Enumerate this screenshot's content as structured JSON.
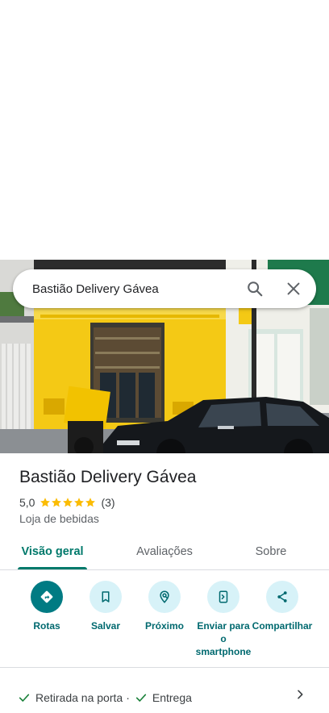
{
  "search": {
    "query": "Bastião Delivery Gávea"
  },
  "place": {
    "name": "Bastião Delivery Gávea",
    "rating": "5,0",
    "rating_value": 5,
    "review_count": "(3)",
    "category": "Loja de bebidas"
  },
  "tabs": [
    {
      "label": "Visão geral",
      "active": true
    },
    {
      "label": "Avaliações",
      "active": false
    },
    {
      "label": "Sobre",
      "active": false
    }
  ],
  "actions": [
    {
      "label": "Rotas",
      "icon": "directions-icon"
    },
    {
      "label": "Salvar",
      "icon": "bookmark-icon"
    },
    {
      "label": "Próximo",
      "icon": "nearby-icon"
    },
    {
      "label": "Enviar para o smartphone",
      "icon": "send-to-phone-icon"
    },
    {
      "label": "Compartilhar",
      "icon": "share-icon"
    }
  ],
  "services": {
    "items": [
      "Retirada na porta",
      "Entrega"
    ],
    "separator": "·"
  },
  "colors": {
    "accent": "#00796b",
    "action_bg": "#d7f2f8",
    "primary_action": "#007b83",
    "star": "#fbbc04",
    "storefront_yellow": "#f4c915"
  }
}
